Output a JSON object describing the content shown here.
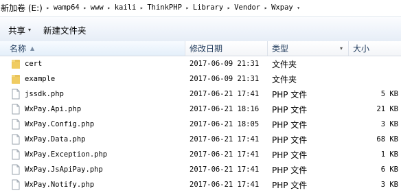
{
  "address_bar": {
    "crumbs": [
      "新加卷 (E:)",
      "wamp64",
      "www",
      "kaili",
      "ThinkPHP",
      "Library",
      "Vendor",
      "Wxpay"
    ]
  },
  "command_bar": {
    "share_label": "共享",
    "new_folder_label": "新建文件夹"
  },
  "columns": {
    "name": "名称",
    "date": "修改日期",
    "type": "类型",
    "size": "大小"
  },
  "files": [
    {
      "name": "cert",
      "date": "2017-06-09 21:31",
      "type": "文件夹",
      "size": "",
      "icon": "folder-icon"
    },
    {
      "name": "example",
      "date": "2017-06-09 21:31",
      "type": "文件夹",
      "size": "",
      "icon": "folder-icon"
    },
    {
      "name": "jssdk.php",
      "date": "2017-06-21 17:41",
      "type": "PHP 文件",
      "size": "5 KB",
      "icon": "file-icon"
    },
    {
      "name": "WxPay.Api.php",
      "date": "2017-06-21 18:16",
      "type": "PHP 文件",
      "size": "21 KB",
      "icon": "file-icon"
    },
    {
      "name": "WxPay.Config.php",
      "date": "2017-06-21 18:05",
      "type": "PHP 文件",
      "size": "3 KB",
      "icon": "file-icon"
    },
    {
      "name": "WxPay.Data.php",
      "date": "2017-06-21 17:41",
      "type": "PHP 文件",
      "size": "68 KB",
      "icon": "file-icon"
    },
    {
      "name": "WxPay.Exception.php",
      "date": "2017-06-21 17:41",
      "type": "PHP 文件",
      "size": "1 KB",
      "icon": "file-icon"
    },
    {
      "name": "WxPay.JsApiPay.php",
      "date": "2017-06-21 17:41",
      "type": "PHP 文件",
      "size": "6 KB",
      "icon": "file-icon"
    },
    {
      "name": "WxPay.Notify.php",
      "date": "2017-06-21 17:41",
      "type": "PHP 文件",
      "size": "3 KB",
      "icon": "file-icon"
    }
  ],
  "colors": {
    "command_bar_bg": "#e9eff7",
    "header_text": "#1e395b",
    "folder": "#e8c25a"
  }
}
